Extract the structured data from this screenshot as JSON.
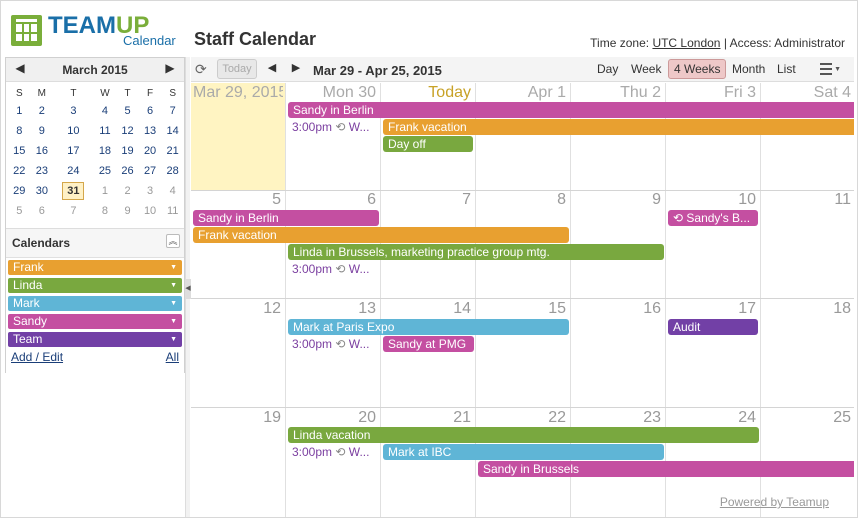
{
  "brand": {
    "word_team": "TEAM",
    "word_up": "UP",
    "sub": "Calendar"
  },
  "page_title": "Staff Calendar",
  "timezone": {
    "label": "Time zone:",
    "value": "UTC London",
    "sep": "|",
    "access": "Access: Administrator"
  },
  "mini_calendar": {
    "month": "March 2015",
    "prev": "◀",
    "next": "▶",
    "weekdays": [
      "S",
      "M",
      "T",
      "W",
      "T",
      "F",
      "S"
    ],
    "weeks": [
      [
        "1",
        "2",
        "3",
        "4",
        "5",
        "6",
        "7"
      ],
      [
        "8",
        "9",
        "10",
        "11",
        "12",
        "13",
        "14"
      ],
      [
        "15",
        "16",
        "17",
        "18",
        "19",
        "20",
        "21"
      ],
      [
        "22",
        "23",
        "24",
        "25",
        "26",
        "27",
        "28"
      ],
      [
        "29",
        "30",
        "31",
        "1",
        "2",
        "3",
        "4"
      ],
      [
        "5",
        "6",
        "7",
        "8",
        "9",
        "10",
        "11"
      ]
    ]
  },
  "calendars": {
    "header": "Calendars",
    "collapse": "︽",
    "items": [
      {
        "label": "Frank",
        "color": "#e8a030"
      },
      {
        "label": "Linda",
        "color": "#79a83f"
      },
      {
        "label": "Mark",
        "color": "#5fb5d6"
      },
      {
        "label": "Sandy",
        "color": "#c44fa1"
      },
      {
        "label": "Team",
        "color": "#7240a6"
      }
    ],
    "add_edit": "Add / Edit",
    "all": "All"
  },
  "toolbar": {
    "today": "Today",
    "prev": "◀",
    "next": "▶",
    "range": "Mar 29 - Apr 25, 2015",
    "views": [
      "Day",
      "Week",
      "4 Weeks",
      "Month",
      "List"
    ],
    "active_view": "4 Weeks"
  },
  "grid": {
    "weeks": [
      [
        "Mar 29, 2015",
        "Mon 30",
        "Today",
        "Apr 1",
        "Thu 2",
        "Fri 3",
        "Sat 4"
      ],
      [
        "5",
        "6",
        "7",
        "8",
        "9",
        "10",
        "11"
      ],
      [
        "12",
        "13",
        "14",
        "15",
        "16",
        "17",
        "18"
      ],
      [
        "19",
        "20",
        "21",
        "22",
        "23",
        "24",
        "25"
      ]
    ]
  },
  "events": {
    "w1_sandy_berlin": "Sandy in Berlin",
    "w1_frank_vac": "Frank vacation",
    "w1_dayoff": "Day off",
    "w1_rep_time": "3:00pm",
    "w1_rep_label": "W...",
    "w2_sandy_berlin": "Sandy in Berlin",
    "w2_frank_vac": "Frank vacation",
    "w2_linda_brussels": "Linda in Brussels, marketing practice group mtg.",
    "w2_rep_time": "3:00pm",
    "w2_rep_label": "W...",
    "w2_sandys_b": "Sandy's B...",
    "w3_mark_paris": "Mark at Paris Expo",
    "w3_rep_time": "3:00pm",
    "w3_rep_label": "W...",
    "w3_sandy_pmg": "Sandy at PMG",
    "w3_audit": "Audit",
    "w4_linda_vac": "Linda vacation",
    "w4_rep_time": "3:00pm",
    "w4_rep_label": "W...",
    "w4_mark_ibc": "Mark at IBC",
    "w4_sandy_brussels": "Sandy in Brussels"
  },
  "footer": {
    "powered": "Powered by Teamup"
  }
}
